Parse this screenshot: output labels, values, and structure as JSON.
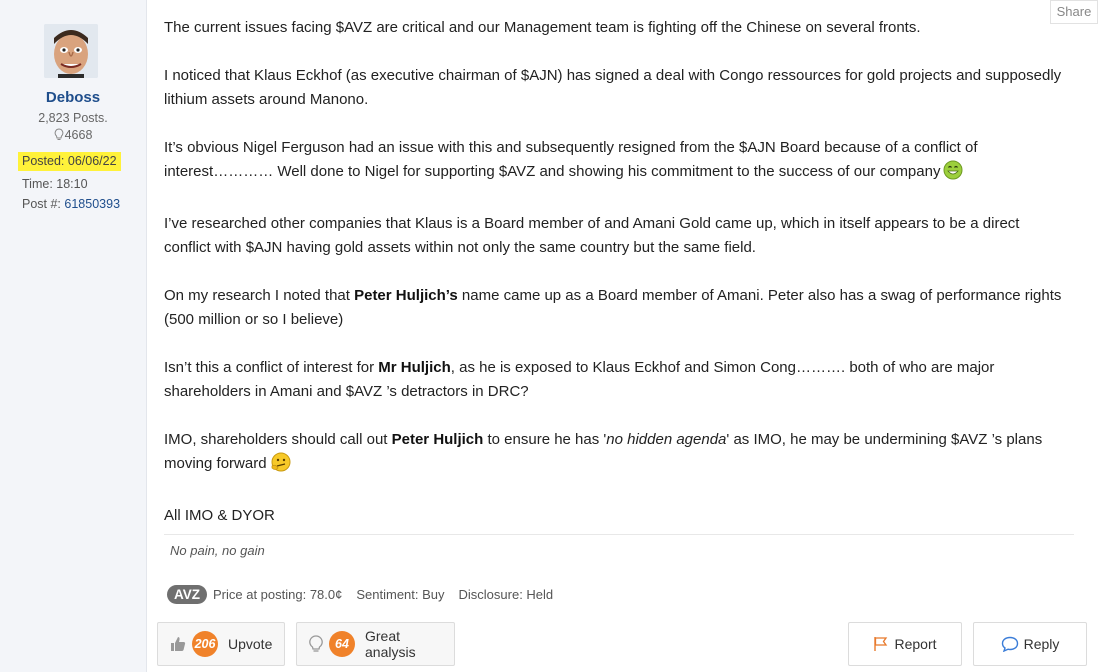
{
  "share_label": "Share",
  "author": {
    "name": "Deboss",
    "posts": "2,823 Posts.",
    "likes": "4668",
    "posted": "Posted: 06/06/22",
    "time": "Time: 18:10",
    "post_no_label": "Post #:",
    "post_no": "61850393"
  },
  "post": {
    "p1": "The current issues facing $AVZ are critical and our Management team is fighting off the Chinese on several fronts.",
    "p2": "I noticed that Klaus Eckhof (as executive chairman of $AJN) has signed a deal with Congo ressources for gold projects and supposedly lithium assets around Manono.",
    "p3": "It’s obvious Nigel Ferguson had an issue with this and subsequently resigned from the $AJN Board because of a conflict of interest………… Well done to Nigel for supporting $AVZ and showing his commitment to the success of our company",
    "p4": "I’ve researched other companies that Klaus is a Board member of and Amani Gold came up, which in itself appears to be a direct conflict with $AJN having gold assets within not only the same country but the same field.",
    "p5_a": "On my research I noted that ",
    "p5_b": "Peter Huljich’s",
    "p5_c": " name came up as a Board member of Amani. Peter also has a swag of performance rights (500 million or so I believe)",
    "p6_a": "Isn’t this a conflict of interest for ",
    "p6_b": "Mr Huljich",
    "p6_c": ", as he is exposed to Klaus Eckhof and Simon Cong………. both of who are major shareholders in Amani and $AVZ ’s detractors in DRC?",
    "p7_a": "IMO, shareholders should call out ",
    "p7_b": "Peter Huljich",
    "p7_c": " to ensure he has '",
    "p7_d": "no hidden agenda",
    "p7_e": "' as IMO, he may be undermining $AVZ ’s plans moving forward",
    "p8": "All IMO & DYOR",
    "signature": "No pain, no gain"
  },
  "stock": {
    "ticker": "AVZ",
    "price": "Price at posting: 78.0¢",
    "sentiment": "Sentiment: Buy",
    "disclosure": "Disclosure: Held"
  },
  "actions": {
    "upvote_count": "206",
    "upvote_label": "Upvote",
    "great_count": "64",
    "great_label": "Great analysis",
    "report_label": "Report",
    "reply_label": "Reply"
  },
  "colors": {
    "sidebar_bg": "#f3f5f9",
    "username": "#1f4e8c",
    "highlight": "#fff23a",
    "count_badge": "#f0822a",
    "ticker_bg": "#6f6f6f"
  },
  "icons": [
    "lightbulb-icon",
    "thumbs-up-icon",
    "flag-icon",
    "speech-bubble-icon",
    "grin-emoji-icon",
    "thinking-emoji-icon"
  ]
}
